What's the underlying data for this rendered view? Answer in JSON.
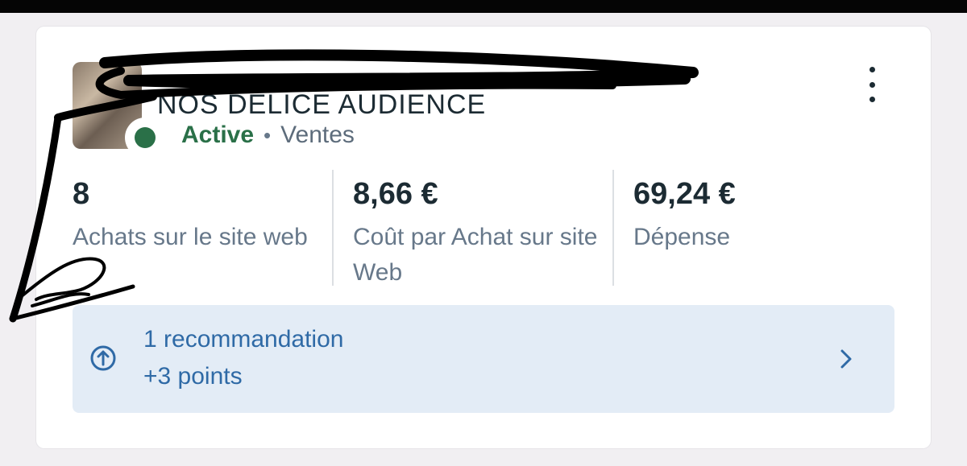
{
  "campaign": {
    "name": "NOS DÉLICE AUDIENCE",
    "status": "Active",
    "separator": "•",
    "objective": "Ventes",
    "status_color": "#2a7048"
  },
  "menu": {
    "icon": "more-vertical-icon"
  },
  "metrics": [
    {
      "value": "8",
      "label": "Achats sur le site web"
    },
    {
      "value": "8,66 €",
      "label": "Coût par Achat sur site Web"
    },
    {
      "value": "69,24 €",
      "label": "Dépense"
    }
  ],
  "recommendation": {
    "title": "1 recommandation",
    "points": "+3 points",
    "icon": "arrow-up-circle-icon",
    "chevron_icon": "chevron-right-icon",
    "accent": "#2f6aa6",
    "background": "#e3ecf6"
  }
}
